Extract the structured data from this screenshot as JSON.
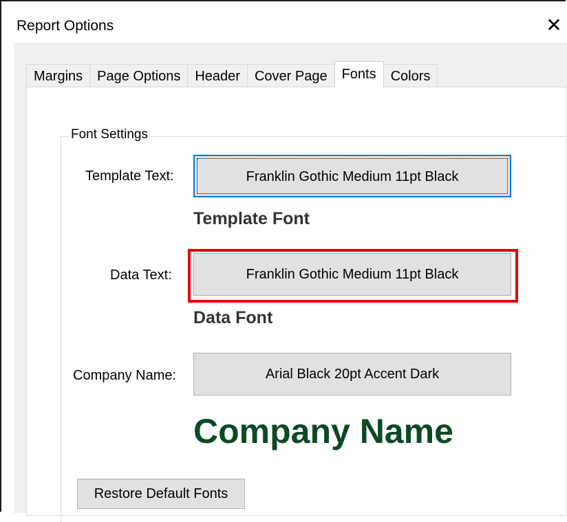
{
  "window": {
    "title": "Report Options"
  },
  "tabs": [
    {
      "label": "Margins"
    },
    {
      "label": "Page Options"
    },
    {
      "label": "Header"
    },
    {
      "label": "Cover Page"
    },
    {
      "label": "Fonts"
    },
    {
      "label": "Colors"
    }
  ],
  "active_tab": "Fonts",
  "font_settings": {
    "legend": "Font Settings",
    "template_text": {
      "label": "Template Text:",
      "button": "Franklin Gothic Medium 11pt Black",
      "preview": "Template Font"
    },
    "data_text": {
      "label": "Data Text:",
      "button": "Franklin Gothic Medium 11pt Black",
      "preview": "Data Font"
    },
    "company_name": {
      "label": "Company Name:",
      "button": "Arial Black 20pt Accent Dark",
      "preview": "Company Name"
    },
    "restore_button": "Restore Default Fonts"
  },
  "colors": {
    "accent_dark": "#0b4a23",
    "preview_text": "#333333",
    "highlight": "#e00000",
    "focus": "#0078d7"
  }
}
